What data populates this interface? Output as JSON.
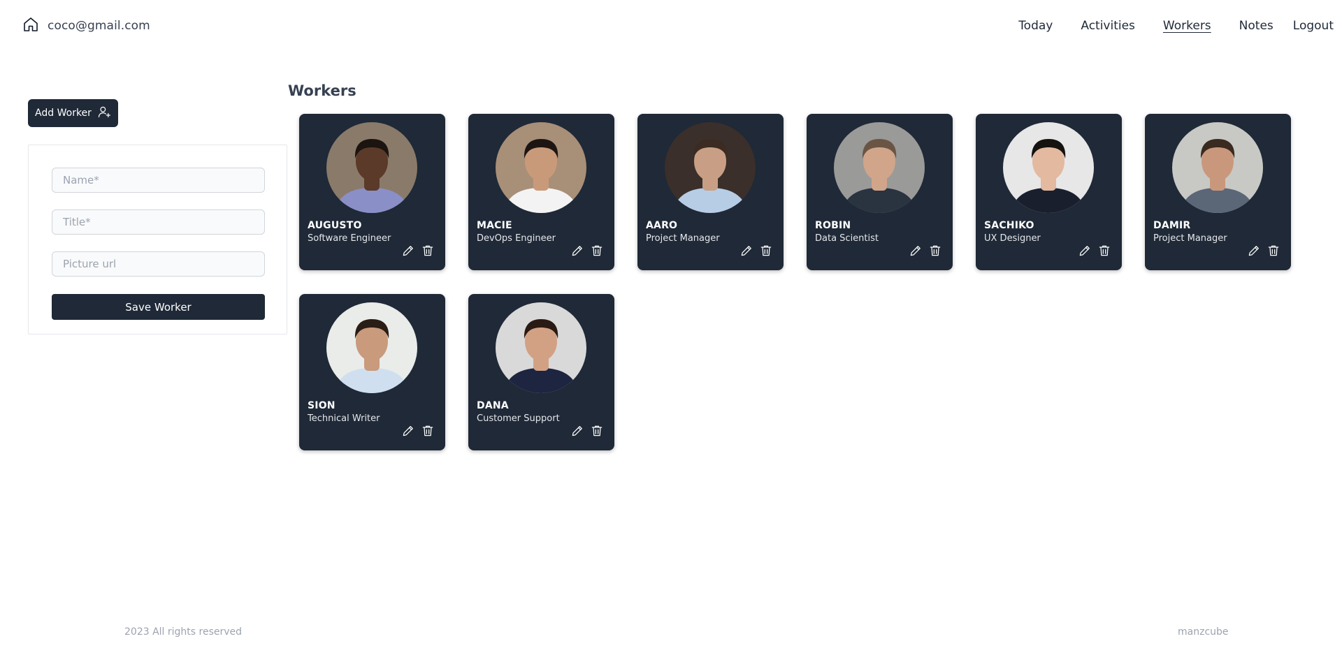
{
  "header": {
    "email": "coco@gmail.com",
    "nav": [
      {
        "label": "Today"
      },
      {
        "label": "Activities"
      },
      {
        "label": "Workers"
      },
      {
        "label": "Notes"
      },
      {
        "label": "Logout"
      }
    ],
    "active_nav": "Workers"
  },
  "sidebar": {
    "add_button_label": "Add Worker",
    "form": {
      "name_placeholder": "Name*",
      "title_placeholder": "Title*",
      "picture_placeholder": "Picture url",
      "save_label": "Save Worker"
    }
  },
  "main": {
    "title": "Workers",
    "workers": [
      {
        "name": "AUGUSTO",
        "title": "Software Engineer",
        "bg": "#8a7a6a",
        "skin": "#5b3a29",
        "hair": "#1b1410",
        "shirt": "#8a8fc8"
      },
      {
        "name": "MACIE",
        "title": "DevOps Engineer",
        "bg": "#a88f78",
        "skin": "#c99a7a",
        "hair": "#1d1512",
        "shirt": "#f3f3f3"
      },
      {
        "name": "AARO",
        "title": "Project Manager",
        "bg": "#3a2f2a",
        "skin": "#c89f85",
        "hair": "#3b2b22",
        "shirt": "#b7cde6"
      },
      {
        "name": "ROBIN",
        "title": "Data Scientist",
        "bg": "#9a9a98",
        "skin": "#d0a58a",
        "hair": "#6a5545",
        "shirt": "#2a3340"
      },
      {
        "name": "SACHIKO",
        "title": "UX Designer",
        "bg": "#e7e7e7",
        "skin": "#e3b9a0",
        "hair": "#161210",
        "shirt": "#1a1f2e"
      },
      {
        "name": "DAMIR",
        "title": "Project Manager",
        "bg": "#c8c9c4",
        "skin": "#c9987c",
        "hair": "#3a2a20",
        "shirt": "#5b6677"
      },
      {
        "name": "SION",
        "title": "Technical Writer",
        "bg": "#e9ece9",
        "skin": "#c99a7c",
        "hair": "#2a1d16",
        "shirt": "#cfdff0"
      },
      {
        "name": "DANA",
        "title": "Customer Support",
        "bg": "#d9d9d9",
        "skin": "#d2a184",
        "hair": "#2a1a14",
        "shirt": "#1d2540"
      }
    ]
  },
  "footer": {
    "copyright": "2023 All rights reserved",
    "brand": "manzcube"
  },
  "colors": {
    "card": "#1f2937",
    "primary_button": "#1f2937",
    "muted_text": "#9ca3af"
  }
}
